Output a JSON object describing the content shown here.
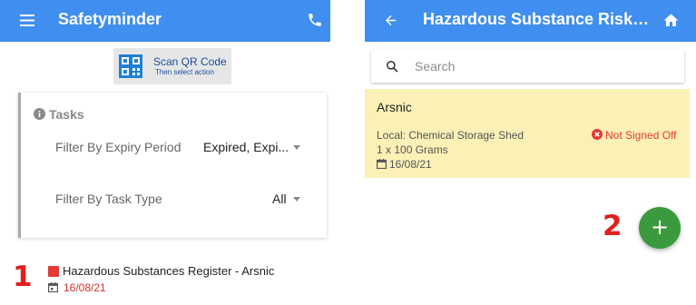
{
  "colors": {
    "appbar": "#3f8ef0",
    "fab": "#3b9a3e",
    "card_highlight": "#fbf0b6",
    "alert": "#e53935",
    "annotation": "#e0201c"
  },
  "annotations": {
    "first": "1",
    "second": "2"
  },
  "left_screen": {
    "app_title": "Safetyminder",
    "menu_icon": "menu-icon",
    "phone_icon": "phone-icon",
    "qr_button": {
      "label": "Scan QR Code",
      "sublabel": "Then select action",
      "icon": "qr-code-icon"
    },
    "tasks": {
      "heading": "Tasks",
      "filters": [
        {
          "label": "Filter By Expiry Period",
          "value": "Expired, Expi..."
        },
        {
          "label": "Filter By Task Type",
          "value": "All"
        }
      ]
    },
    "task_item": {
      "title": "Hazardous Substances Register - Arsnic",
      "date": "16/08/21",
      "status_color": "#e53935"
    }
  },
  "right_screen": {
    "title": "Hazardous Substance Risk As...",
    "back_icon": "arrow-left-icon",
    "home_icon": "home-icon",
    "search": {
      "placeholder": "Search",
      "value": ""
    },
    "substance": {
      "name": "Arsnic",
      "location": "Local: Chemical Storage Shed",
      "quantity": "1 x 100 Grams",
      "date": "16/08/21",
      "status": "Not Signed Off"
    },
    "fab_label": "+"
  }
}
